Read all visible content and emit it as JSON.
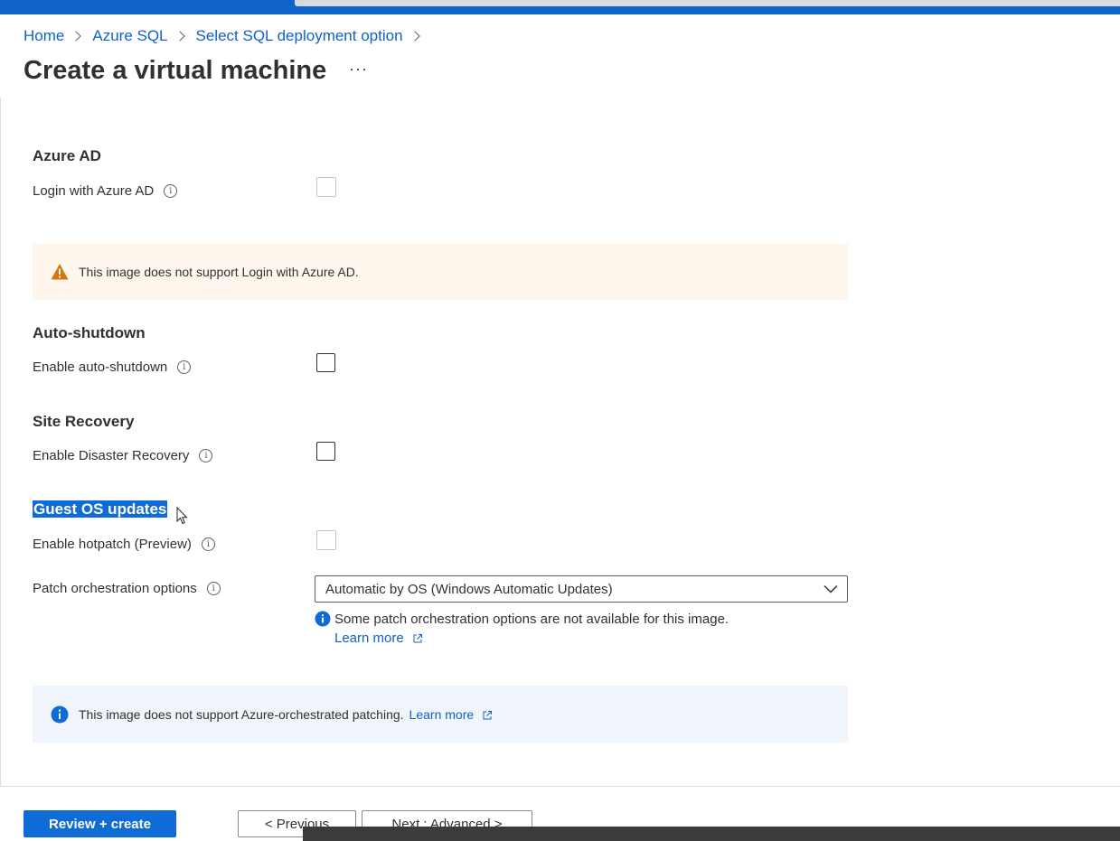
{
  "breadcrumb": [
    "Home",
    "Azure SQL",
    "Select SQL deployment option"
  ],
  "page_title": "Create a virtual machine",
  "more_label": "···",
  "sections": {
    "azure_ad": {
      "heading": "Azure AD",
      "login_label": "Login with Azure AD",
      "warning": "This image does not support Login with Azure AD."
    },
    "auto_shutdown": {
      "heading": "Auto-shutdown",
      "enable_label": "Enable auto-shutdown"
    },
    "site_recovery": {
      "heading": "Site Recovery",
      "enable_label": "Enable Disaster Recovery"
    },
    "guest_os": {
      "heading": "Guest OS updates",
      "hotpatch_label": "Enable hotpatch (Preview)",
      "patch_label": "Patch orchestration options",
      "patch_value": "Automatic by OS (Windows Automatic Updates)",
      "patch_note": "Some patch orchestration options are not available for this image.",
      "learn_more": "Learn more",
      "banner_text": "This image does not support Azure-orchestrated patching.",
      "banner_link": "Learn more"
    }
  },
  "footer": {
    "review_create": "Review + create",
    "previous": "< Previous",
    "next": "Next : Advanced >"
  },
  "colors": {
    "accent": "#0f6bd6",
    "link": "#0f62c9",
    "warning_icon": "#d9730d",
    "warning_bg": "#fff7ee",
    "info_bg": "#f0f4fb"
  }
}
